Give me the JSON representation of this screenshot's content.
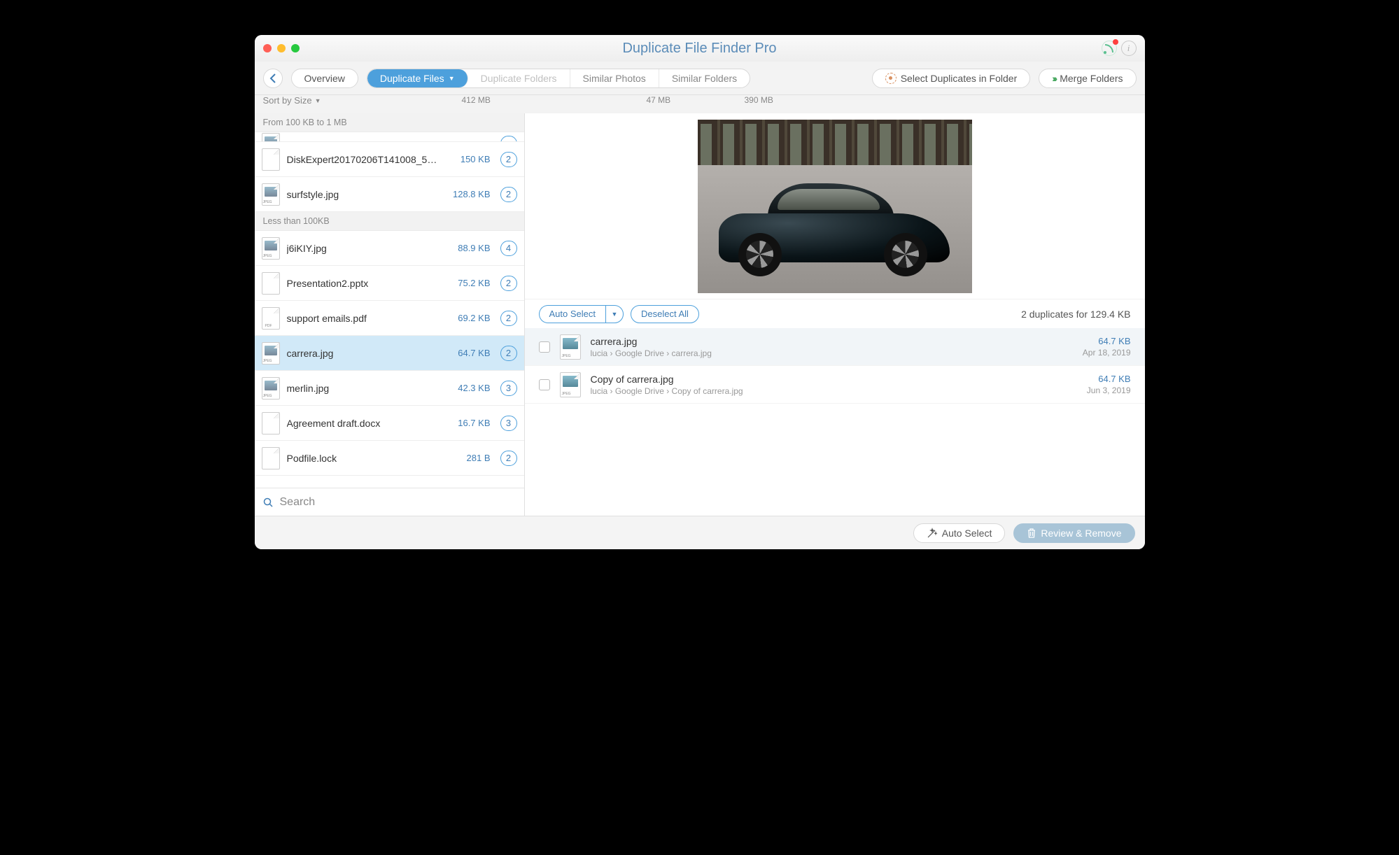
{
  "title": "Duplicate File Finder Pro",
  "toolbar": {
    "overview": "Overview",
    "segments": [
      {
        "label": "Duplicate Files",
        "size": "412 MB",
        "active": true,
        "bar": 58
      },
      {
        "label": "Duplicate Folders",
        "size": "",
        "disabled": true,
        "bar": 0
      },
      {
        "label": "Similar Photos",
        "size": "47 MB",
        "bar": 70
      },
      {
        "label": "Similar Folders",
        "size": "390 MB",
        "bar": 80
      }
    ],
    "select_folder": "Select Duplicates in Folder",
    "merge": "Merge Folders"
  },
  "sort_label": "Sort by Size",
  "sidebar": {
    "groups": [
      {
        "header": "From 100 KB to 1 MB",
        "items": [
          {
            "name": "DiskExpert20170206T141008_5…",
            "size": "150 KB",
            "count": "2",
            "type": "doc"
          },
          {
            "name": "surfstyle.jpg",
            "size": "128.8 KB",
            "count": "2",
            "type": "jpeg"
          }
        ]
      },
      {
        "header": "Less than 100KB",
        "items": [
          {
            "name": "j6iKIY.jpg",
            "size": "88.9 KB",
            "count": "4",
            "type": "jpeg"
          },
          {
            "name": "Presentation2.pptx",
            "size": "75.2 KB",
            "count": "2",
            "type": "doc"
          },
          {
            "name": "support emails.pdf",
            "size": "69.2 KB",
            "count": "2",
            "type": "pdf"
          },
          {
            "name": "carrera.jpg",
            "size": "64.7 KB",
            "count": "2",
            "type": "jpeg",
            "selected": true
          },
          {
            "name": "merlin.jpg",
            "size": "42.3 KB",
            "count": "3",
            "type": "jpeg"
          },
          {
            "name": "Agreement draft.docx",
            "size": "16.7 KB",
            "count": "3",
            "type": "doc"
          },
          {
            "name": "Podfile.lock",
            "size": "281 B",
            "count": "2",
            "type": "doc"
          }
        ]
      }
    ],
    "search": "Search"
  },
  "content": {
    "auto_select": "Auto Select",
    "deselect_all": "Deselect All",
    "summary": "2 duplicates for 129.4 KB",
    "duplicates": [
      {
        "name": "carrera.jpg",
        "path": "lucia  ›  Google Drive  ›  carrera.jpg",
        "size": "64.7 KB",
        "date": "Apr 18, 2019",
        "sel": true
      },
      {
        "name": "Copy of carrera.jpg",
        "path": "lucia  ›  Google Drive  ›  Copy of carrera.jpg",
        "size": "64.7 KB",
        "date": "Jun 3, 2019"
      }
    ]
  },
  "footer": {
    "auto_select": "Auto Select",
    "review": "Review & Remove"
  }
}
